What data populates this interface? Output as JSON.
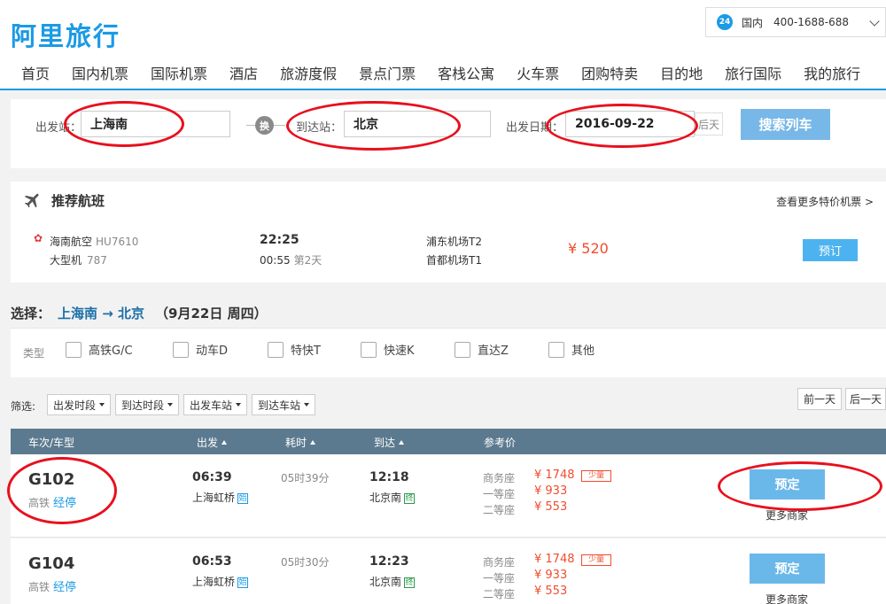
{
  "header": {
    "logo": "阿里旅行",
    "hotline": {
      "badge": "24",
      "region": "国内",
      "phone": "400-1688-688"
    },
    "nav": [
      "首页",
      "国内机票",
      "国际机票",
      "酒店",
      "旅游度假",
      "景点门票",
      "客栈公寓",
      "火车票",
      "团购特卖",
      "目的地",
      "旅行国际",
      "我的旅行"
    ]
  },
  "search": {
    "from_label": "出发站：",
    "from_value": "上海南",
    "swap_label": "换",
    "to_label": "到达站：",
    "to_value": "北京",
    "date_label": "出发日期：",
    "date_value": "2016-09-22",
    "next_day_label": "后天",
    "button_label": "搜索列车"
  },
  "recommended_flight": {
    "title": "推荐航班",
    "more_link": "查看更多特价机票 >",
    "airline": "海南航空",
    "flight_no": "HU7610",
    "plane_type": "大型机",
    "plane_code": "787",
    "depart_time": "22:25",
    "arrive_time": "00:55",
    "arrive_day": "第2天",
    "from_airport": "浦东机场T2",
    "to_airport": "首都机场T1",
    "price": "¥ 520",
    "book_label": "预订"
  },
  "selection": {
    "prefix": "选择：",
    "route": "上海南 → 北京",
    "date": "（9月22日 周四）"
  },
  "type_filter": {
    "label": "类型",
    "options": [
      "高铁G/C",
      "动车D",
      "特快T",
      "快速K",
      "直达Z",
      "其他"
    ]
  },
  "filters": {
    "label": "筛选:",
    "dropdowns": [
      "出发时段",
      "到达时段",
      "出发车站",
      "到达车站"
    ],
    "prev_day": "前一天",
    "next_day": "后一天"
  },
  "table": {
    "headers": [
      "车次/车型",
      "出发",
      "耗时",
      "到达",
      "参考价"
    ],
    "rows": [
      {
        "train_no": "G102",
        "train_type": "高铁",
        "stops_label": "经停",
        "depart_time": "06:39",
        "depart_station": "上海虹桥",
        "depart_tag": "始",
        "duration": "05时39分",
        "arrive_time": "12:18",
        "arrive_station": "北京南",
        "arrive_tag": "终",
        "seats": [
          {
            "name": "商务座",
            "price": "¥ 1748",
            "tag": "少量"
          },
          {
            "name": "一等座",
            "price": "¥ 933"
          },
          {
            "name": "二等座",
            "price": "¥ 553"
          }
        ],
        "book_label": "预定",
        "more_label": "更多商家"
      },
      {
        "train_no": "G104",
        "train_type": "高铁",
        "stops_label": "经停",
        "depart_time": "06:53",
        "depart_station": "上海虹桥",
        "depart_tag": "始",
        "duration": "05时30分",
        "arrive_time": "12:23",
        "arrive_station": "北京南",
        "arrive_tag": "终",
        "seats": [
          {
            "name": "商务座",
            "price": "¥ 1748",
            "tag": "少量"
          },
          {
            "name": "一等座",
            "price": "¥ 933"
          },
          {
            "name": "二等座",
            "price": "¥ 553"
          }
        ],
        "book_label": "预定",
        "more_label": "更多商家"
      }
    ]
  },
  "colors": {
    "brand_blue": "#1b9ae6",
    "price_red": "#f04c2e",
    "annotation_red": "#e8101e",
    "table_header": "#5c7a8f"
  }
}
